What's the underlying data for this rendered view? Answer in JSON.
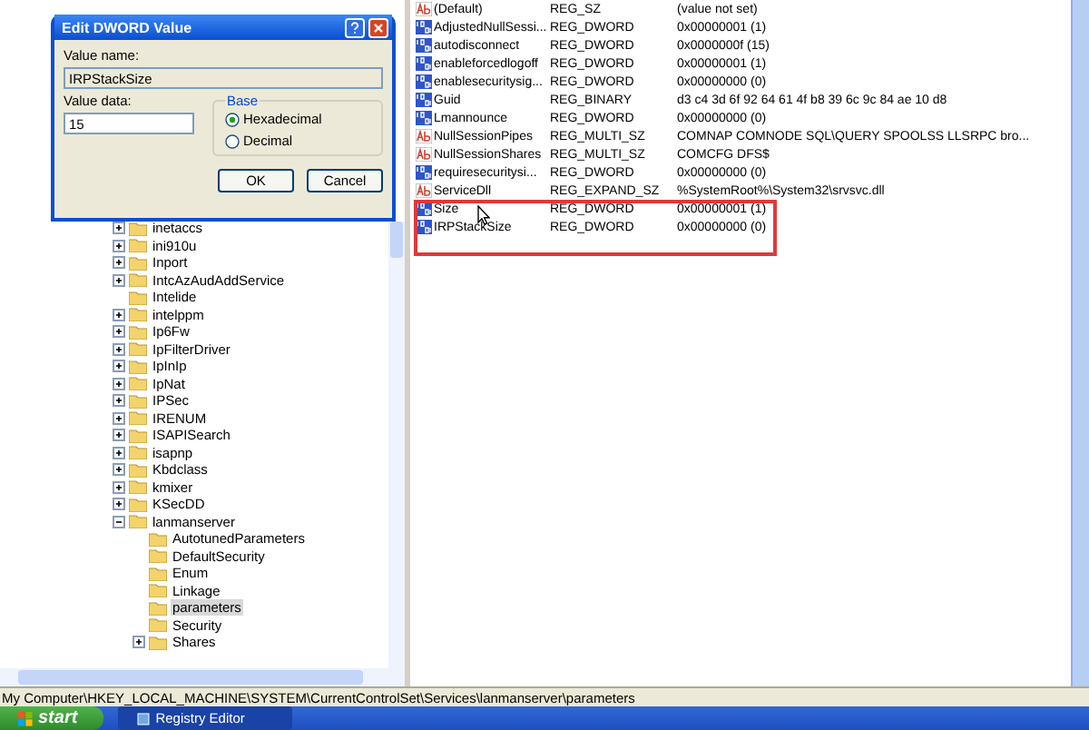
{
  "dialog": {
    "title": "Edit DWORD Value",
    "value_name_label": "Value name:",
    "value_name": "IRPStackSize",
    "value_data_label": "Value data:",
    "value_data": "15",
    "base_label": "Base",
    "base_options": [
      {
        "label": "Hexadecimal",
        "selected": true
      },
      {
        "label": "Decimal",
        "selected": false
      }
    ],
    "buttons": [
      "OK",
      "Cancel"
    ]
  },
  "tree": {
    "items": [
      {
        "label": "inetaccs",
        "expanded": false
      },
      {
        "label": "ini910u",
        "expanded": false
      },
      {
        "label": "Inport",
        "expanded": false
      },
      {
        "label": "IntcAzAudAddService",
        "expanded": false
      },
      {
        "label": "Intelide"
      },
      {
        "label": "intelppm",
        "expanded": false
      },
      {
        "label": "Ip6Fw",
        "expanded": false
      },
      {
        "label": "IpFilterDriver",
        "expanded": false
      },
      {
        "label": "IpInIp",
        "expanded": false
      },
      {
        "label": "IpNat",
        "expanded": false
      },
      {
        "label": "IPSec",
        "expanded": false
      },
      {
        "label": "IRENUM",
        "expanded": false
      },
      {
        "label": "ISAPISearch",
        "expanded": false
      },
      {
        "label": "isapnp",
        "expanded": false
      },
      {
        "label": "Kbdclass",
        "expanded": false
      },
      {
        "label": "kmixer",
        "expanded": false
      },
      {
        "label": "KSecDD",
        "expanded": false
      },
      {
        "label": "lanmanserver",
        "expanded": true,
        "children": [
          {
            "label": "AutotunedParameters"
          },
          {
            "label": "DefaultSecurity"
          },
          {
            "label": "Enum"
          },
          {
            "label": "Linkage"
          },
          {
            "label": "parameters",
            "selected": true
          },
          {
            "label": "Security"
          },
          {
            "label": "Shares",
            "expanded": false
          }
        ]
      }
    ]
  },
  "values": {
    "rows": [
      {
        "kind": "string",
        "name": "(Default)",
        "type": "REG_SZ",
        "data": "(value not set)"
      },
      {
        "kind": "binary",
        "name": "AdjustedNullSessi...",
        "type": "REG_DWORD",
        "data": "0x00000001 (1)"
      },
      {
        "kind": "binary",
        "name": "autodisconnect",
        "type": "REG_DWORD",
        "data": "0x0000000f (15)"
      },
      {
        "kind": "binary",
        "name": "enableforcedlogoff",
        "type": "REG_DWORD",
        "data": "0x00000001 (1)"
      },
      {
        "kind": "binary",
        "name": "enablesecuritysig...",
        "type": "REG_DWORD",
        "data": "0x00000000 (0)"
      },
      {
        "kind": "binary",
        "name": "Guid",
        "type": "REG_BINARY",
        "data": "d3 c4 3d 6f 92 64 61 4f b8 39 6c 9c 84 ae 10 d8"
      },
      {
        "kind": "binary",
        "name": "Lmannounce",
        "type": "REG_DWORD",
        "data": "0x00000000 (0)"
      },
      {
        "kind": "string",
        "name": "NullSessionPipes",
        "type": "REG_MULTI_SZ",
        "data": "COMNAP COMNODE SQL\\QUERY SPOOLSS LLSRPC bro..."
      },
      {
        "kind": "string",
        "name": "NullSessionShares",
        "type": "REG_MULTI_SZ",
        "data": "COMCFG DFS$"
      },
      {
        "kind": "binary",
        "name": "requiresecuritysi...",
        "type": "REG_DWORD",
        "data": "0x00000000 (0)"
      },
      {
        "kind": "string",
        "name": "ServiceDll",
        "type": "REG_EXPAND_SZ",
        "data": "%SystemRoot%\\System32\\srvsvc.dll"
      },
      {
        "kind": "binary",
        "name": "Size",
        "type": "REG_DWORD",
        "data": "0x00000001 (1)"
      },
      {
        "kind": "binary",
        "name": "IRPStackSize",
        "type": "REG_DWORD",
        "data": "0x00000000 (0)"
      }
    ]
  },
  "status_bar": "My Computer\\HKEY_LOCAL_MACHINE\\SYSTEM\\CurrentControlSet\\Services\\lanmanserver\\parameters",
  "taskbar": {
    "start": "start",
    "tasks": [
      {
        "label": "Registry Editor",
        "selected": true
      }
    ]
  }
}
